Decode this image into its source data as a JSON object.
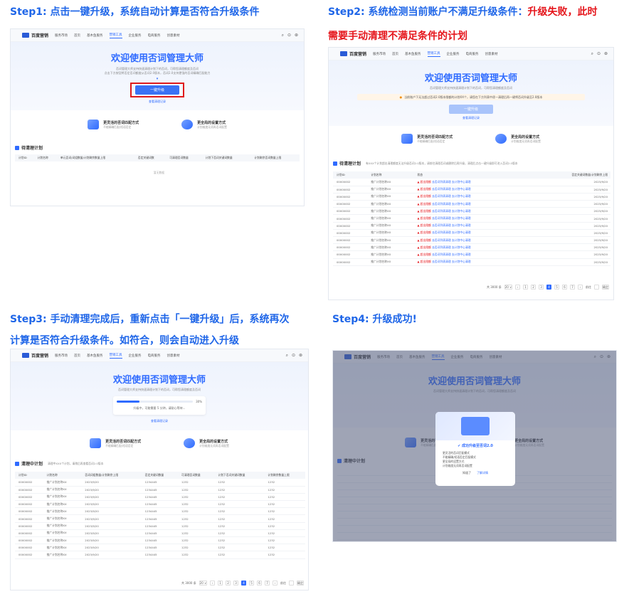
{
  "steps": {
    "s1": {
      "text": "Step1: 点击一键升级，系统自动计算是否符合升级条件"
    },
    "s2": {
      "line1_a": "Step2: 系统检测当前账户不满足升级条件：",
      "line1_b": "升级失败，此时",
      "line2": "需要手动清理不满足条件的计划"
    },
    "s3": {
      "line1": "Step3: 手动清理完成后，重新点击「一键升级」后，系统再次",
      "line2": "计算是否符合升级条件。如符合，则会自动进入升级"
    },
    "s4": {
      "text": "Step4: 升级成功!"
    }
  },
  "nav": {
    "logo": "百度营销",
    "market": "服务市场",
    "items": [
      "首页",
      "基木鱼服务",
      "营销工具",
      "企业服务",
      "电商服务",
      "创意素材"
    ],
    "active": 2,
    "icons": [
      "search-icon",
      "help-icon",
      "user-icon"
    ]
  },
  "hero": {
    "title": "欢迎使用否词管理大师",
    "sub1": "否词管理大师支持快速清理计划下的否词，可帮您清理额度及否词",
    "sub2": "点击下方按钮将否定否词额度从否词2.0版本，否词2.0支持更强的否词精确匹配能力",
    "button": "一键升级",
    "link": "查看清理记录",
    "warn": "当前账户下无法超过否词2.0版本限额的计划XX个，请您在下方列表中逐一清理后再一键将否词升级至2.0版本",
    "progress_text": "升级中，可能需要 5 分钟，请耐心等待...",
    "progress_pct": "30%"
  },
  "cards": [
    {
      "title": "更灵活的否词匹配方式",
      "sub": "不能精确匹配/短语否定"
    },
    {
      "title": "更全局的设置方式",
      "sub": "计划维度无须再否词配置"
    }
  ],
  "s1table": {
    "section": "待清理计划",
    "headers": [
      "计划ID",
      "计划名称",
      "单元否词/词组数量/计划剩余数量上限",
      "否定关键词数",
      "可清理否词数量",
      "计划下否词关键词数量",
      "计划剩余否词数量上限"
    ],
    "empty": "暂无数据"
  },
  "s2table": {
    "section": "待清理计划",
    "note": "有XXX个计划超出清理额度无法升级否词2.0版本，请前往清理否词或删除后再升级，清理后点击一键升级即可进入否词2.0版本",
    "headers": [
      "计划ID",
      "计划名称",
      "状态",
      "否定关键词数量/计划剩余上限"
    ],
    "rows": [
      [
        "00000002",
        "推广计划名称XX",
        "超出限额",
        "去否词列表清理",
        "去计划中心清理",
        "2023/9/20"
      ],
      [
        "00000002",
        "推广计划名称XX",
        "超出限额",
        "去否词列表清理",
        "去计划中心清理",
        "2023/9/20"
      ],
      [
        "00000002",
        "推广计划名称XX",
        "超出限额",
        "去否词列表清理",
        "去计划中心清理",
        "2023/9/20"
      ],
      [
        "00000002",
        "推广计划名称XX",
        "超出限额",
        "去否词列表清理",
        "去计划中心清理",
        "2023/9/20"
      ],
      [
        "00000002",
        "推广计划名称XX",
        "超出限额",
        "去否词列表清理",
        "去计划中心清理",
        "2023/9/20"
      ],
      [
        "00000002",
        "推广计划名称XX",
        "超出限额",
        "去否词列表清理",
        "去计划中心清理",
        "2023/9/20"
      ],
      [
        "00000002",
        "推广计划名称XX",
        "超出限额",
        "去否词列表清理",
        "去计划中心清理",
        "2023/9/20"
      ],
      [
        "00000002",
        "推广计划名称XX",
        "超出限额",
        "去否词列表清理",
        "去计划中心清理",
        "2023/9/20"
      ],
      [
        "00000002",
        "推广计划名称XX",
        "超出限额",
        "去否词列表清理",
        "去计划中心清理",
        "2023/9/20"
      ],
      [
        "00000002",
        "推广计划名称XX",
        "超出限额",
        "去否词列表清理",
        "去计划中心清理",
        "2023/9/20"
      ],
      [
        "00000002",
        "推广计划名称XX",
        "超出限额",
        "去否词列表清理",
        "去计划中心清理",
        "2023/9/20"
      ],
      [
        "00000002",
        "推广计划名称XX",
        "超出限额",
        "去否词列表清理",
        "去计划中心清理",
        "2023/9/20"
      ]
    ]
  },
  "s3table": {
    "section": "清理中计划",
    "note": "清理中XXX个计划，请稍后再查看否词2.0版本",
    "headers": [
      "计划ID",
      "计划名称",
      "否词词组数量/计划剩余上限",
      "否定关键词数量",
      "可清理否词数量",
      "计划下否词关键词数量",
      "计划剩余数量上限"
    ],
    "rows": [
      [
        "00000002",
        "推广计划名称XX",
        "2023/9/20",
        "1234445",
        "1232",
        "1232",
        "1232"
      ],
      [
        "00000002",
        "推广计划名称XX",
        "2023/9/20",
        "1234445",
        "1232",
        "1232",
        "1232"
      ],
      [
        "00000002",
        "推广计划名称XX",
        "2023/9/20",
        "1234445",
        "1232",
        "1232",
        "1232"
      ],
      [
        "00000002",
        "推广计划名称XX",
        "2023/9/20",
        "1234445",
        "1232",
        "1232",
        "1232"
      ],
      [
        "00000002",
        "推广计划名称XX",
        "2023/9/20",
        "1234445",
        "1232",
        "1232",
        "1232"
      ],
      [
        "00000002",
        "推广计划名称XX",
        "2023/9/20",
        "1234445",
        "1232",
        "1232",
        "1232"
      ],
      [
        "00000002",
        "推广计划名称XX",
        "2023/9/20",
        "1234445",
        "1232",
        "1232",
        "1232"
      ],
      [
        "00000002",
        "推广计划名称XX",
        "2023/9/20",
        "1234445",
        "1232",
        "1232",
        "1232"
      ],
      [
        "00000002",
        "推广计划名称XX",
        "2023/9/20",
        "1234445",
        "1232",
        "1232",
        "1232"
      ],
      [
        "00000002",
        "推广计划名称XX",
        "2023/9/20",
        "1234445",
        "1232",
        "1232",
        "1232"
      ],
      [
        "00000002",
        "推广计划名称XX",
        "2023/9/20",
        "1234445",
        "1232",
        "1232",
        "1232"
      ]
    ]
  },
  "pager": {
    "total": "共 3000 条",
    "size": "20 ∨",
    "pages": [
      "‹",
      "1",
      "2",
      "3",
      "4",
      "5",
      "6",
      "7",
      "›"
    ],
    "active": "4",
    "goto": "前往",
    "go": "确定"
  },
  "modal": {
    "title": "成功升级至否词2.0",
    "items": [
      "更灵活的否词匹配模式",
      "不能精确/短语否定匹配模式",
      "更全局的设置方式",
      "计划维度无须再否词配置"
    ],
    "btn1": "知道了",
    "btn2": "了解详情"
  }
}
